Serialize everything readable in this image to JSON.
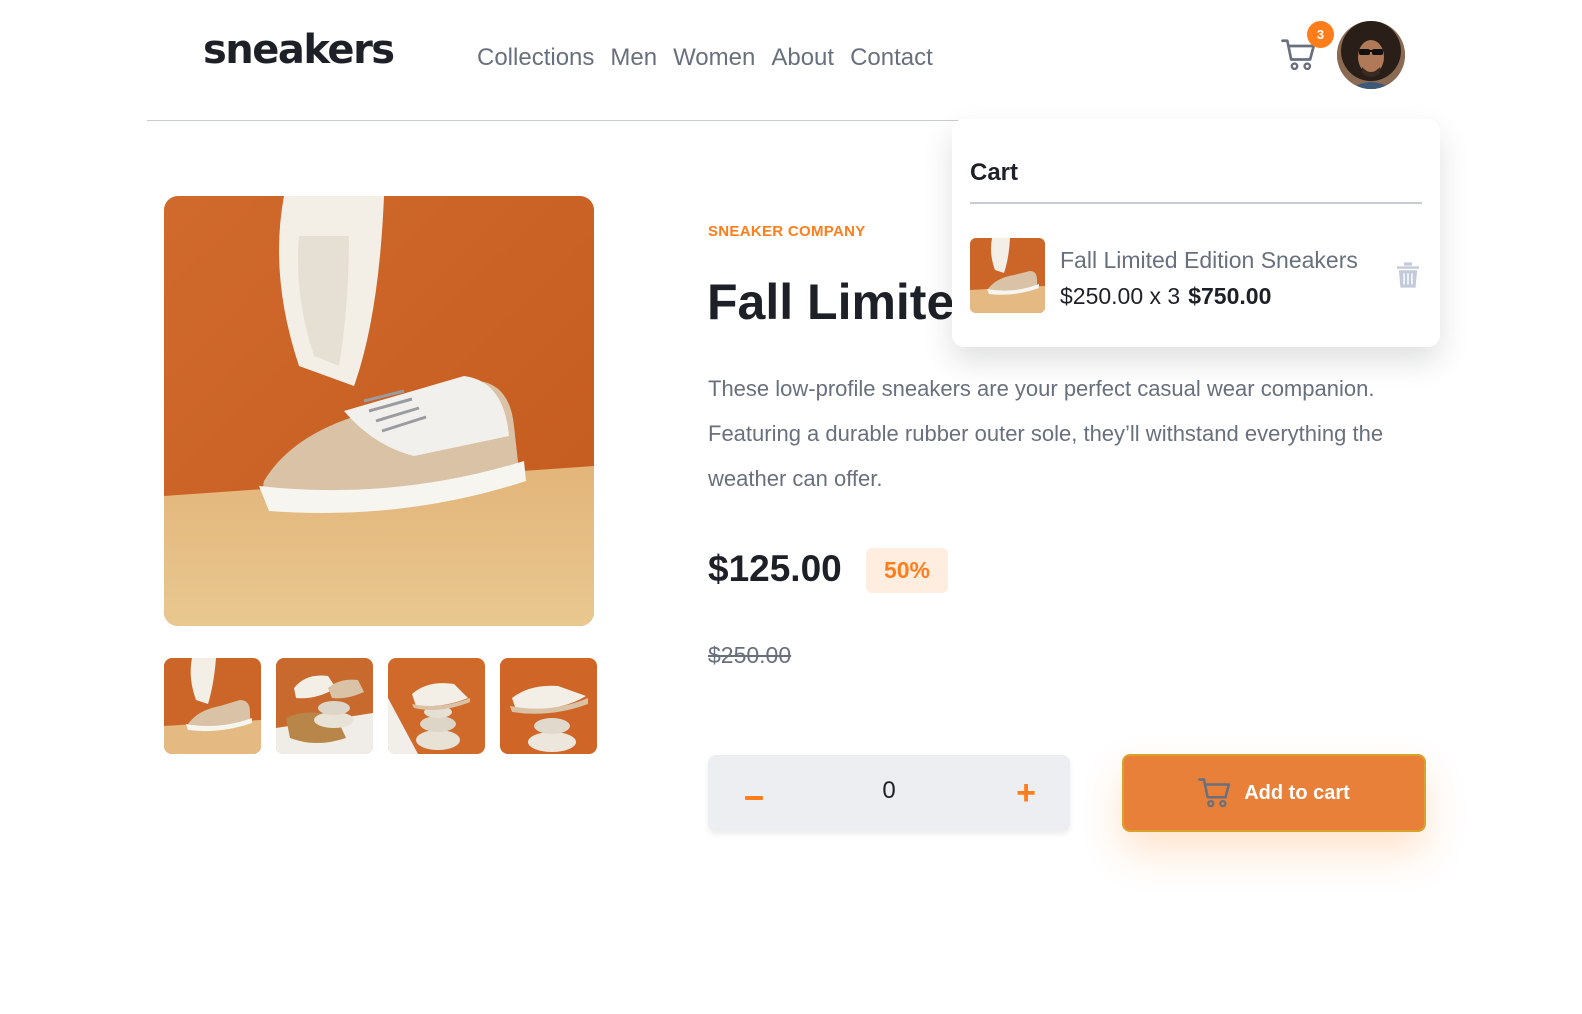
{
  "header": {
    "logo": "sneakers",
    "nav": [
      "Collections",
      "Men",
      "Women",
      "About",
      "Contact"
    ],
    "cart_count": "3"
  },
  "product": {
    "company": "SNEAKER COMPANY",
    "title": "Fall Limited Edition Sneakers",
    "description": "These low-profile sneakers are your perfect casual wear companion. Featuring a durable rubber outer sole, they’ll withstand everything the weather can offer.",
    "price": "$125.00",
    "discount": "50%",
    "old_price": "$250.00",
    "quantity": "0",
    "add_to_cart": "Add to cart"
  },
  "cart": {
    "title": "Cart",
    "item_name": "Fall Limited Edition Sneakers",
    "item_unit": "$250.00 x 3",
    "item_total": "$750.00"
  },
  "colors": {
    "accent": "#ff7e1b",
    "accent_light": "#ffede0",
    "text_dark": "#1d2026",
    "text_grey": "#69707d"
  }
}
